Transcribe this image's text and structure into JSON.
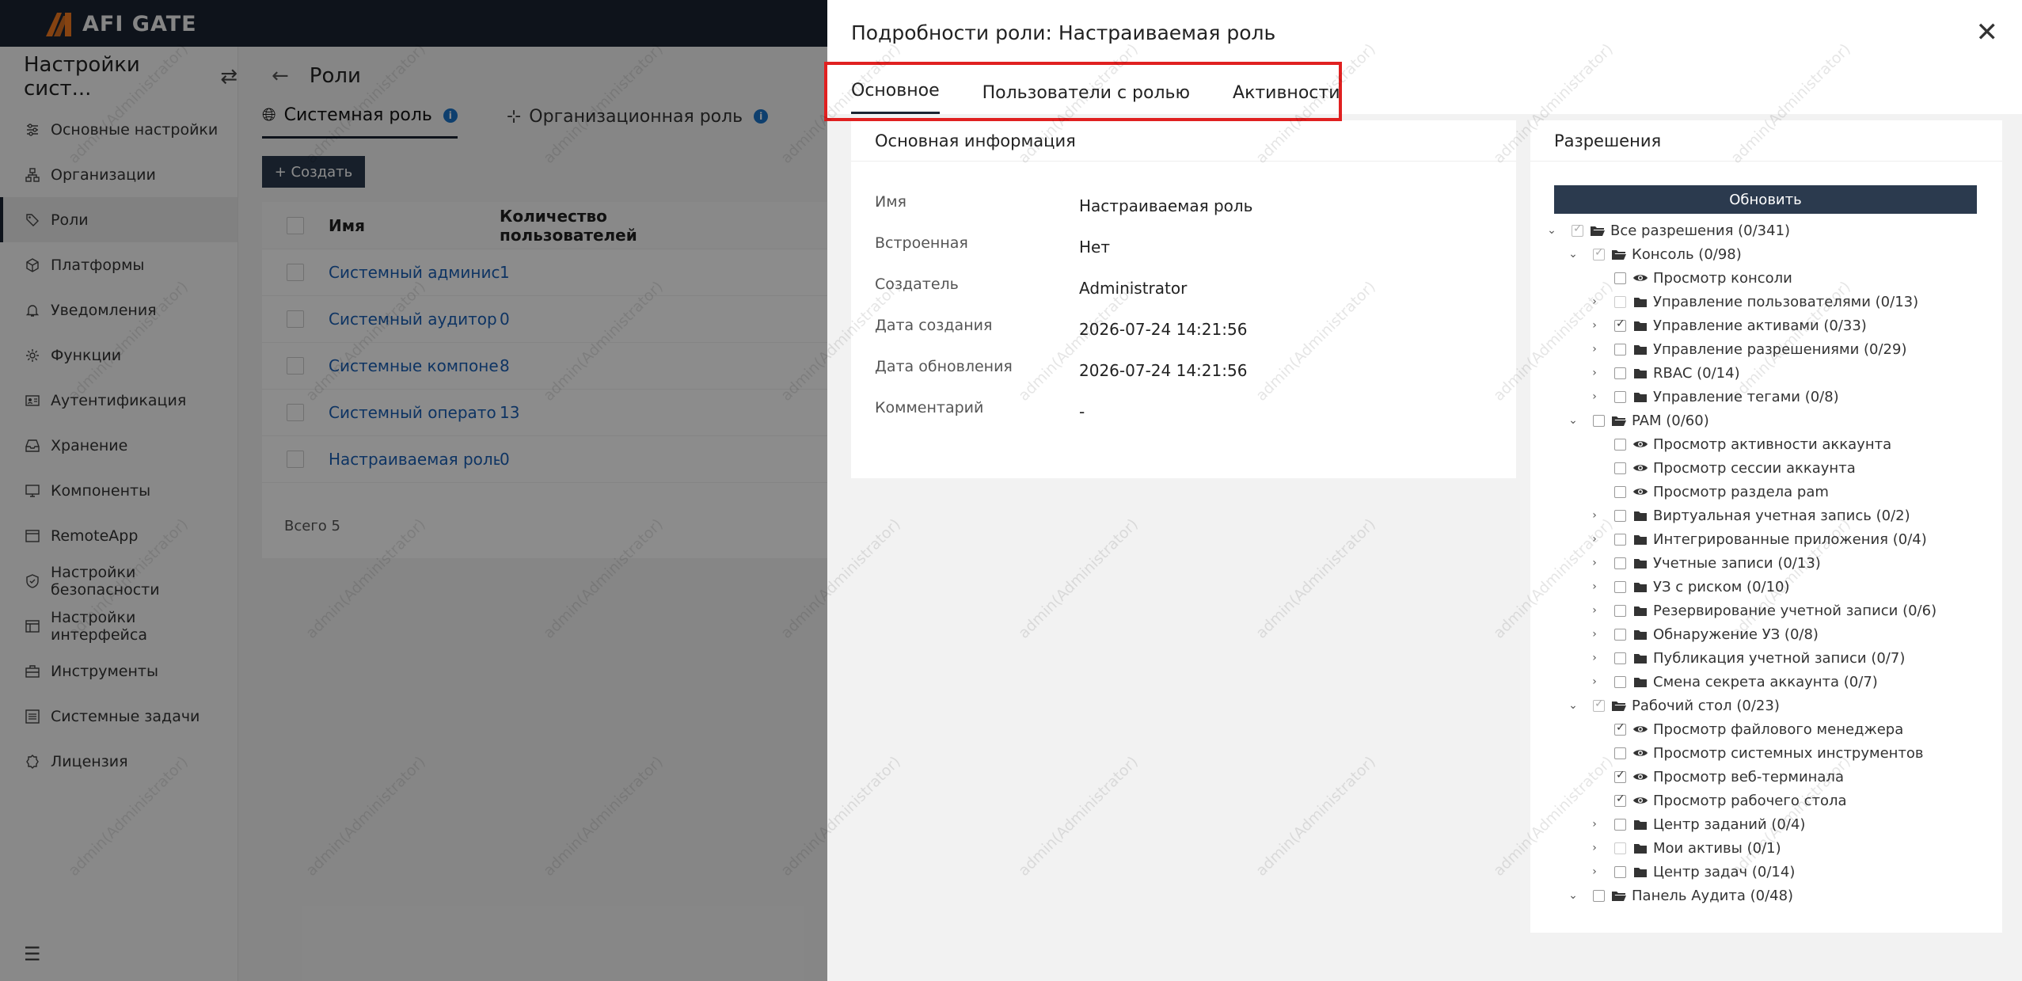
{
  "brand": {
    "name": "AFI GATE",
    "accent": "#f47b20"
  },
  "sidebar": {
    "title": "Настройки сист...",
    "items": [
      {
        "label": "Основные настройки",
        "icon": "sliders-icon"
      },
      {
        "label": "Организации",
        "icon": "sitemap-icon"
      },
      {
        "label": "Роли",
        "icon": "user-tag-icon",
        "active": true
      },
      {
        "label": "Платформы",
        "icon": "cube-icon"
      },
      {
        "label": "Уведомления",
        "icon": "bell-icon"
      },
      {
        "label": "Функции",
        "icon": "cog-icon"
      },
      {
        "label": "Аутентификация",
        "icon": "id-card-icon"
      },
      {
        "label": "Хранение",
        "icon": "inbox-icon"
      },
      {
        "label": "Компоненты",
        "icon": "monitor-icon"
      },
      {
        "label": "RemoteApp",
        "icon": "app-window-icon"
      },
      {
        "label1": "Настройки",
        "label2": "безопасности",
        "icon": "shield-icon"
      },
      {
        "label1": "Настройки",
        "label2": "интерфейса",
        "icon": "layout-icon"
      },
      {
        "label": "Инструменты",
        "icon": "toolbox-icon"
      },
      {
        "label": "Системные задачи",
        "icon": "list-icon"
      },
      {
        "label": "Лицензия",
        "icon": "badge-icon"
      }
    ]
  },
  "main": {
    "title": "Роли",
    "tabs": [
      {
        "label": "Системная роль"
      },
      {
        "label": "Организационная роль"
      }
    ],
    "create_label": "+ Создать",
    "table": {
      "columns": [
        "Имя",
        "Количество пользователей"
      ],
      "rows": [
        {
          "name": "Системный админис",
          "count": "1"
        },
        {
          "name": "Системный аудитор",
          "count": "0"
        },
        {
          "name": "Системные компоне",
          "count": "8"
        },
        {
          "name": "Системный операто",
          "count": "13"
        },
        {
          "name": "Настраиваемая роль",
          "count": "0"
        }
      ],
      "total": "Всего 5"
    }
  },
  "drawer": {
    "title": "Подробности роли: Настраиваемая роль",
    "tabs": [
      "Основное",
      "Пользователи с ролью",
      "Активности"
    ],
    "basic": {
      "title": "Основная информация",
      "rows": [
        {
          "label": "Имя",
          "value": "Настраиваемая роль"
        },
        {
          "label": "Встроенная",
          "value": "Нет"
        },
        {
          "label": "Создатель",
          "value": "Administrator"
        },
        {
          "label": "Дата создания",
          "value": "2026-07-24 14:21:56"
        },
        {
          "label": "Дата обновления",
          "value": "2026-07-24 14:21:56"
        },
        {
          "label": "Комментарий",
          "value": "-"
        }
      ]
    },
    "permissions": {
      "title": "Разрешения",
      "refresh_label": "Обновить",
      "tree": [
        {
          "level": 0,
          "expand": "open",
          "check": "half",
          "icon": "folder-open",
          "label": "Все разрешения (0/341)"
        },
        {
          "level": 1,
          "expand": "open",
          "check": "half",
          "icon": "folder-open",
          "label": "Консоль (0/98)"
        },
        {
          "level": 2,
          "expand": "none",
          "check": "none",
          "icon": "eye",
          "label": "Просмотр консоли"
        },
        {
          "level": 2,
          "expand": "closed",
          "check": "faint",
          "icon": "folder",
          "label": "Управление пользователями (0/13)"
        },
        {
          "level": 2,
          "expand": "closed",
          "check": "checked",
          "icon": "folder",
          "label": "Управление активами (0/33)"
        },
        {
          "level": 2,
          "expand": "closed",
          "check": "none",
          "icon": "folder",
          "label": "Управление разрешениями (0/29)"
        },
        {
          "level": 2,
          "expand": "closed",
          "check": "none",
          "icon": "folder",
          "label": "RBAC (0/14)"
        },
        {
          "level": 2,
          "expand": "closed",
          "check": "none",
          "icon": "folder",
          "label": "Управление тегами (0/8)"
        },
        {
          "level": 1,
          "expand": "open",
          "check": "none",
          "icon": "folder-open",
          "label": "PAM (0/60)"
        },
        {
          "level": 2,
          "expand": "none",
          "check": "none",
          "icon": "eye",
          "label": "Просмотр активности аккаунта"
        },
        {
          "level": 2,
          "expand": "none",
          "check": "none",
          "icon": "eye",
          "label": "Просмотр сессии аккаунта"
        },
        {
          "level": 2,
          "expand": "none",
          "check": "none",
          "icon": "eye",
          "label": "Просмотр раздела pam"
        },
        {
          "level": 2,
          "expand": "closed",
          "check": "none",
          "icon": "folder",
          "label": "Виртуальная учетная запись (0/2)"
        },
        {
          "level": 2,
          "expand": "closed",
          "check": "none",
          "icon": "folder",
          "label": "Интегрированные приложения (0/4)"
        },
        {
          "level": 2,
          "expand": "closed",
          "check": "none",
          "icon": "folder",
          "label": "Учетные записи (0/13)"
        },
        {
          "level": 2,
          "expand": "closed",
          "check": "none",
          "icon": "folder",
          "label": "УЗ с риском (0/10)"
        },
        {
          "level": 2,
          "expand": "closed",
          "check": "none",
          "icon": "folder",
          "label": "Резервирование учетной записи (0/6)"
        },
        {
          "level": 2,
          "expand": "closed",
          "check": "none",
          "icon": "folder",
          "label": "Обнаружение УЗ (0/8)"
        },
        {
          "level": 2,
          "expand": "closed",
          "check": "none",
          "icon": "folder",
          "label": "Публикация учетной записи (0/7)"
        },
        {
          "level": 2,
          "expand": "closed",
          "check": "none",
          "icon": "folder",
          "label": "Смена секрета аккаунта (0/7)"
        },
        {
          "level": 1,
          "expand": "open",
          "check": "half",
          "icon": "folder-open",
          "label": "Рабочий стол (0/23)"
        },
        {
          "level": 2,
          "expand": "none",
          "check": "checked",
          "icon": "eye",
          "label": "Просмотр файлового менеджера"
        },
        {
          "level": 2,
          "expand": "none",
          "check": "none",
          "icon": "eye",
          "label": "Просмотр системных инструментов"
        },
        {
          "level": 2,
          "expand": "none",
          "check": "checked",
          "icon": "eye",
          "label": "Просмотр веб-терминала"
        },
        {
          "level": 2,
          "expand": "none",
          "check": "checked",
          "icon": "eye",
          "label": "Просмотр рабочего стола"
        },
        {
          "level": 2,
          "expand": "closed",
          "check": "none",
          "icon": "folder",
          "label": "Центр заданий (0/4)"
        },
        {
          "level": 2,
          "expand": "closed",
          "check": "faint",
          "icon": "folder",
          "label": "Мои активы (0/1)"
        },
        {
          "level": 2,
          "expand": "closed",
          "check": "none",
          "icon": "folder",
          "label": "Центр задач (0/14)"
        },
        {
          "level": 1,
          "expand": "open",
          "check": "none",
          "icon": "folder-open",
          "label": "Панель Аудита (0/48)"
        }
      ]
    }
  },
  "watermark": "admin(Administrator)"
}
